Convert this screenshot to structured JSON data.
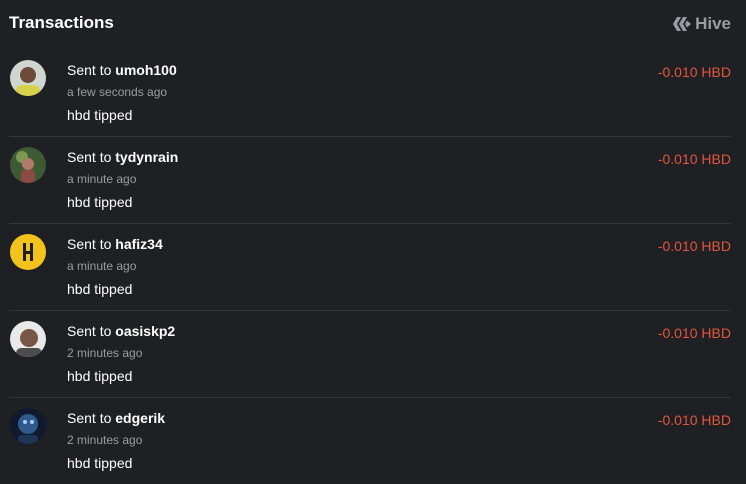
{
  "header": {
    "title": "Transactions",
    "brand_label": "Hive",
    "brand_icon": "hive-logo-icon"
  },
  "colors": {
    "background": "#1f2023",
    "amount_negative": "#e2553e",
    "muted_text": "#9a9ca1"
  },
  "transactions": [
    {
      "prefix": "Sent to",
      "user": "umoh100",
      "time": "a few seconds ago",
      "memo": "hbd tipped",
      "amount": "-0.010 HBD"
    },
    {
      "prefix": "Sent to",
      "user": "tydynrain",
      "time": "a minute ago",
      "memo": "hbd tipped",
      "amount": "-0.010 HBD"
    },
    {
      "prefix": "Sent to",
      "user": "hafiz34",
      "time": "a minute ago",
      "memo": "hbd tipped",
      "amount": "-0.010 HBD"
    },
    {
      "prefix": "Sent to",
      "user": "oasiskp2",
      "time": "2 minutes ago",
      "memo": "hbd tipped",
      "amount": "-0.010 HBD"
    },
    {
      "prefix": "Sent to",
      "user": "edgerik",
      "time": "2 minutes ago",
      "memo": "hbd tipped",
      "amount": "-0.010 HBD"
    }
  ]
}
